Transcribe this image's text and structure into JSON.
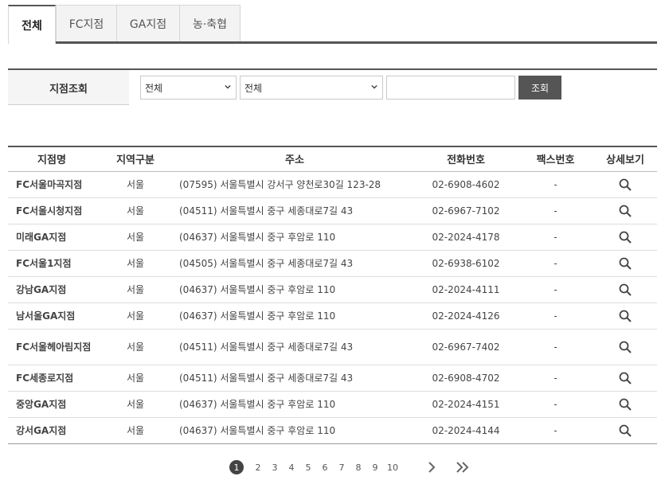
{
  "tabs": [
    {
      "label": "전체",
      "active": true
    },
    {
      "label": "FC지점",
      "active": false
    },
    {
      "label": "GA지점",
      "active": false
    },
    {
      "label": "농·축협",
      "active": false
    }
  ],
  "search": {
    "label": "지점조회",
    "select1": "전체",
    "select2": "전체",
    "query": "",
    "button": "조회"
  },
  "table": {
    "headers": [
      "지점명",
      "지역구분",
      "주소",
      "전화번호",
      "팩스번호",
      "상세보기"
    ],
    "rows": [
      {
        "name": "FC서울마곡지점",
        "region": "서울",
        "address": "(07595) 서울특별시 강서구 양천로30길 123-28",
        "phone": "02-6908-4602",
        "fax": "-"
      },
      {
        "name": "FC서울시청지점",
        "region": "서울",
        "address": "(04511) 서울특별시 중구 세종대로7길 43",
        "phone": "02-6967-7102",
        "fax": "-"
      },
      {
        "name": "미래GA지점",
        "region": "서울",
        "address": "(04637) 서울특별시 중구 후암로 110",
        "phone": "02-2024-4178",
        "fax": "-"
      },
      {
        "name": "FC서울1지점",
        "region": "서울",
        "address": "(04505) 서울특별시 중구 세종대로7길 43",
        "phone": "02-6938-6102",
        "fax": "-"
      },
      {
        "name": "강남GA지점",
        "region": "서울",
        "address": "(04637) 서울특별시 중구 후암로 110",
        "phone": "02-2024-4111",
        "fax": "-"
      },
      {
        "name": "남서울GA지점",
        "region": "서울",
        "address": "(04637) 서울특별시 중구 후암로 110",
        "phone": "02-2024-4126",
        "fax": "-"
      },
      {
        "name": "FC서울헤아림지점",
        "region": "서울",
        "address": "(04511) 서울특별시 중구 세종대로7길 43",
        "phone": "02-6967-7402",
        "fax": "-"
      },
      {
        "name": "FC세종로지점",
        "region": "서울",
        "address": "(04511) 서울특별시 중구 세종대로7길 43",
        "phone": "02-6908-4702",
        "fax": "-"
      },
      {
        "name": "중앙GA지점",
        "region": "서울",
        "address": "(04637) 서울특별시 중구 후암로 110",
        "phone": "02-2024-4151",
        "fax": "-"
      },
      {
        "name": "강서GA지점",
        "region": "서울",
        "address": "(04637) 서울특별시 중구 후암로 110",
        "phone": "02-2024-4144",
        "fax": "-"
      }
    ],
    "detail_icon": "search-icon"
  },
  "pagination": {
    "current": 1,
    "pages": [
      "1",
      "2",
      "3",
      "4",
      "5",
      "6",
      "7",
      "8",
      "9",
      "10"
    ],
    "next_icon": "chevron-right-icon",
    "last_icon": "double-chevron-right-icon"
  }
}
